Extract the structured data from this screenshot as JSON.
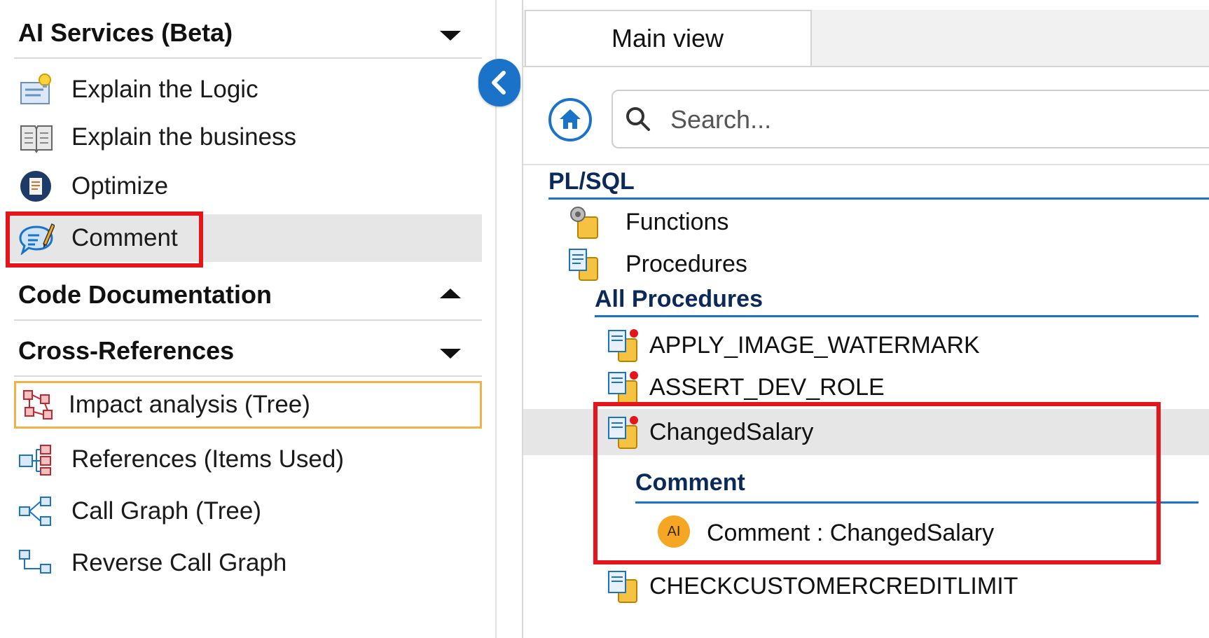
{
  "left": {
    "ai_services": {
      "title": "AI Services (Beta)",
      "items": [
        {
          "label": "Explain the Logic",
          "icon": "lightbulb-doc-icon"
        },
        {
          "label": "Explain the business",
          "icon": "book-icon"
        },
        {
          "label": "Optimize",
          "icon": "optimize-icon"
        },
        {
          "label": "Comment",
          "icon": "comment-pencil-icon"
        }
      ]
    },
    "code_documentation": {
      "title": "Code Documentation"
    },
    "cross_references": {
      "title": "Cross-References",
      "items": [
        {
          "label": "Impact analysis (Tree)",
          "icon": "impact-tree-icon"
        },
        {
          "label": "References (Items Used)",
          "icon": "references-icon"
        },
        {
          "label": "Call Graph (Tree)",
          "icon": "call-graph-icon"
        },
        {
          "label": "Reverse Call Graph",
          "icon": "reverse-call-graph-icon"
        }
      ]
    }
  },
  "right": {
    "tab": {
      "label": "Main view"
    },
    "search": {
      "placeholder": "Search..."
    },
    "tree": {
      "plsql_header": "PL/SQL",
      "functions_label": "Functions",
      "procedures_label": "Procedures",
      "all_procedures_header": "All Procedures",
      "procedures": [
        "APPLY_IMAGE_WATERMARK",
        "ASSERT_DEV_ROLE",
        "ChangedSalary",
        "CHECKCUSTOMERCREDITLIMIT"
      ],
      "comment_header": "Comment",
      "comment_item_label": "Comment : ChangedSalary",
      "ai_badge": "AI"
    }
  },
  "colors": {
    "accent_blue": "#1a73c9",
    "highlight_red": "#e5161b",
    "focus_orange": "#f0b34a",
    "header_navy": "#0b2a5a",
    "ai_badge": "#f5a623",
    "selected_row": "#e6e6e6"
  }
}
